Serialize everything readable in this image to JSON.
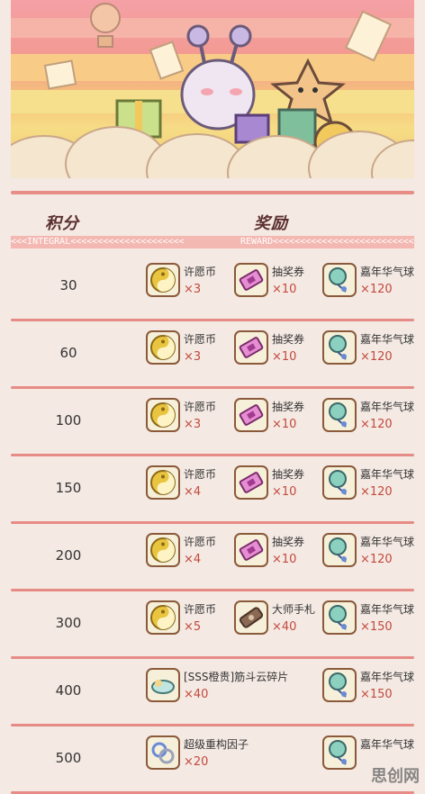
{
  "header": {
    "points_label": "积分",
    "rewards_label": "奖励",
    "ribbon_left": "<<<INTEGRAL<<<<<<<<<<<<<<<<<<<<<",
    "ribbon_right": "REWARD<<<<<<<<<<<<<<<<<<<<<<<<<<<<<<"
  },
  "rows": [
    {
      "points": "30",
      "rewards": [
        {
          "name": "许愿币",
          "qty": "×3",
          "icon": "coin-icon"
        },
        {
          "name": "抽奖券",
          "qty": "×10",
          "icon": "ticket-icon"
        },
        {
          "name": "嘉年华气球",
          "qty": "×120",
          "icon": "balloon-icon"
        }
      ]
    },
    {
      "points": "60",
      "rewards": [
        {
          "name": "许愿币",
          "qty": "×3",
          "icon": "coin-icon"
        },
        {
          "name": "抽奖券",
          "qty": "×10",
          "icon": "ticket-icon"
        },
        {
          "name": "嘉年华气球",
          "qty": "×120",
          "icon": "balloon-icon"
        }
      ]
    },
    {
      "points": "100",
      "rewards": [
        {
          "name": "许愿币",
          "qty": "×3",
          "icon": "coin-icon"
        },
        {
          "name": "抽奖券",
          "qty": "×10",
          "icon": "ticket-icon"
        },
        {
          "name": "嘉年华气球",
          "qty": "×120",
          "icon": "balloon-icon"
        }
      ]
    },
    {
      "points": "150",
      "rewards": [
        {
          "name": "许愿币",
          "qty": "×4",
          "icon": "coin-icon"
        },
        {
          "name": "抽奖券",
          "qty": "×10",
          "icon": "ticket-icon"
        },
        {
          "name": "嘉年华气球",
          "qty": "×120",
          "icon": "balloon-icon"
        }
      ]
    },
    {
      "points": "200",
      "rewards": [
        {
          "name": "许愿币",
          "qty": "×4",
          "icon": "coin-icon"
        },
        {
          "name": "抽奖券",
          "qty": "×10",
          "icon": "ticket-icon"
        },
        {
          "name": "嘉年华气球",
          "qty": "×120",
          "icon": "balloon-icon"
        }
      ]
    },
    {
      "points": "300",
      "rewards": [
        {
          "name": "许愿币",
          "qty": "×5",
          "icon": "coin-icon"
        },
        {
          "name": "大师手札",
          "qty": "×40",
          "icon": "scroll-icon"
        },
        {
          "name": "嘉年华气球",
          "qty": "×150",
          "icon": "balloon-icon"
        }
      ]
    },
    {
      "points": "400",
      "rewards": [
        {
          "name": "[SSS橙贵]筋斗云碎片",
          "qty": "×40",
          "icon": "cloud-fragment-icon"
        },
        {
          "name": "嘉年华气球",
          "qty": "×150",
          "icon": "balloon-icon"
        }
      ]
    },
    {
      "points": "500",
      "rewards": [
        {
          "name": "超级重构因子",
          "qty": "×20",
          "icon": "rings-icon"
        },
        {
          "name": "嘉年华气球",
          "qty": "",
          "icon": "balloon-icon"
        }
      ]
    }
  ],
  "watermark": "思创网"
}
